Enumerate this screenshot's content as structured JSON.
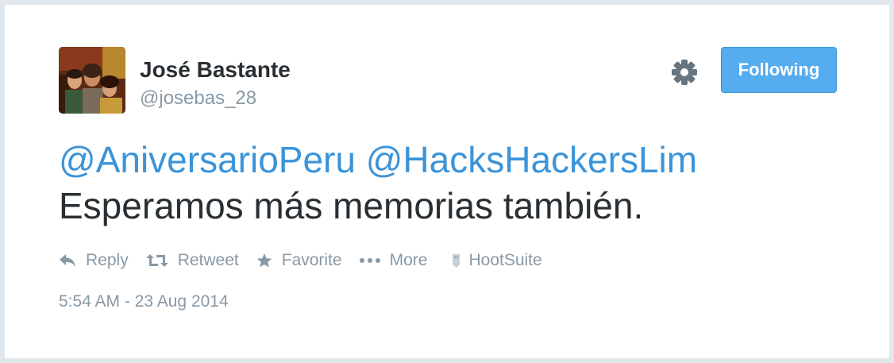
{
  "user": {
    "name": "José Bastante",
    "handle": "@josebas_28"
  },
  "header": {
    "settings_icon": "gear-icon",
    "follow_button_label": "Following",
    "follow_button_color": "#55acee"
  },
  "tweet": {
    "mention_1": "@AniversarioPeru",
    "mention_2": "@HacksHackersLim",
    "body": "Esperamos más memorias también.",
    "mention_color": "#3b94d9"
  },
  "actions": {
    "reply": {
      "label": "Reply",
      "icon": "reply-icon"
    },
    "retweet": {
      "label": "Retweet",
      "icon": "retweet-icon"
    },
    "favorite": {
      "label": "Favorite",
      "icon": "star-icon"
    },
    "more": {
      "label": "More",
      "icon": "ellipsis-icon"
    }
  },
  "source": {
    "label": "HootSuite",
    "icon": "hootsuite-icon"
  },
  "timestamp": "5:54 AM - 23 Aug 2014"
}
